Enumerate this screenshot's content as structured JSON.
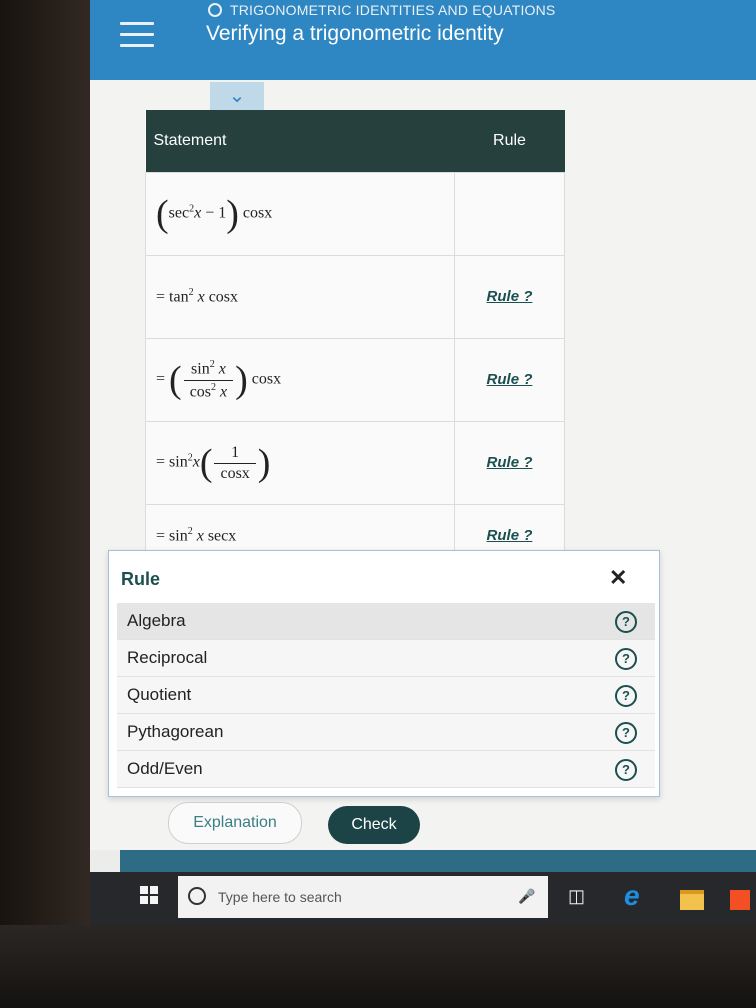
{
  "header": {
    "topic": "TRIGONOMETRIC IDENTITIES AND EQUATIONS",
    "title": "Verifying a trigonometric identity"
  },
  "table": {
    "col_statement": "Statement",
    "col_rule": "Rule",
    "rows": [
      {
        "rule": ""
      },
      {
        "rule": "Rule ?"
      },
      {
        "rule": "Rule ?"
      },
      {
        "rule": "Rule ?"
      },
      {
        "rule": "Rule ?"
      }
    ]
  },
  "math": {
    "sec": "sec",
    "tan": "tan",
    "sin": "sin",
    "cos": "cos",
    "x": "x",
    "sq": "2",
    "minus_one": "− 1",
    "one": "1",
    "eq": "=",
    "cosx": "cosx",
    "secx": "secx"
  },
  "popup": {
    "title": "Rule",
    "close": "✕",
    "options": [
      "Algebra",
      "Reciprocal",
      "Quotient",
      "Pythagorean",
      "Odd/Even"
    ],
    "help": "?"
  },
  "buttons": {
    "explanation": "Explanation",
    "check": "Check"
  },
  "taskbar": {
    "search_placeholder": "Type here to search"
  },
  "icons": [
    "menu-icon",
    "chevron-down-icon",
    "close-icon",
    "help-icon",
    "windows-icon",
    "search-icon",
    "mic-icon",
    "task-view-icon",
    "edge-icon",
    "folder-icon",
    "store-icon"
  ]
}
